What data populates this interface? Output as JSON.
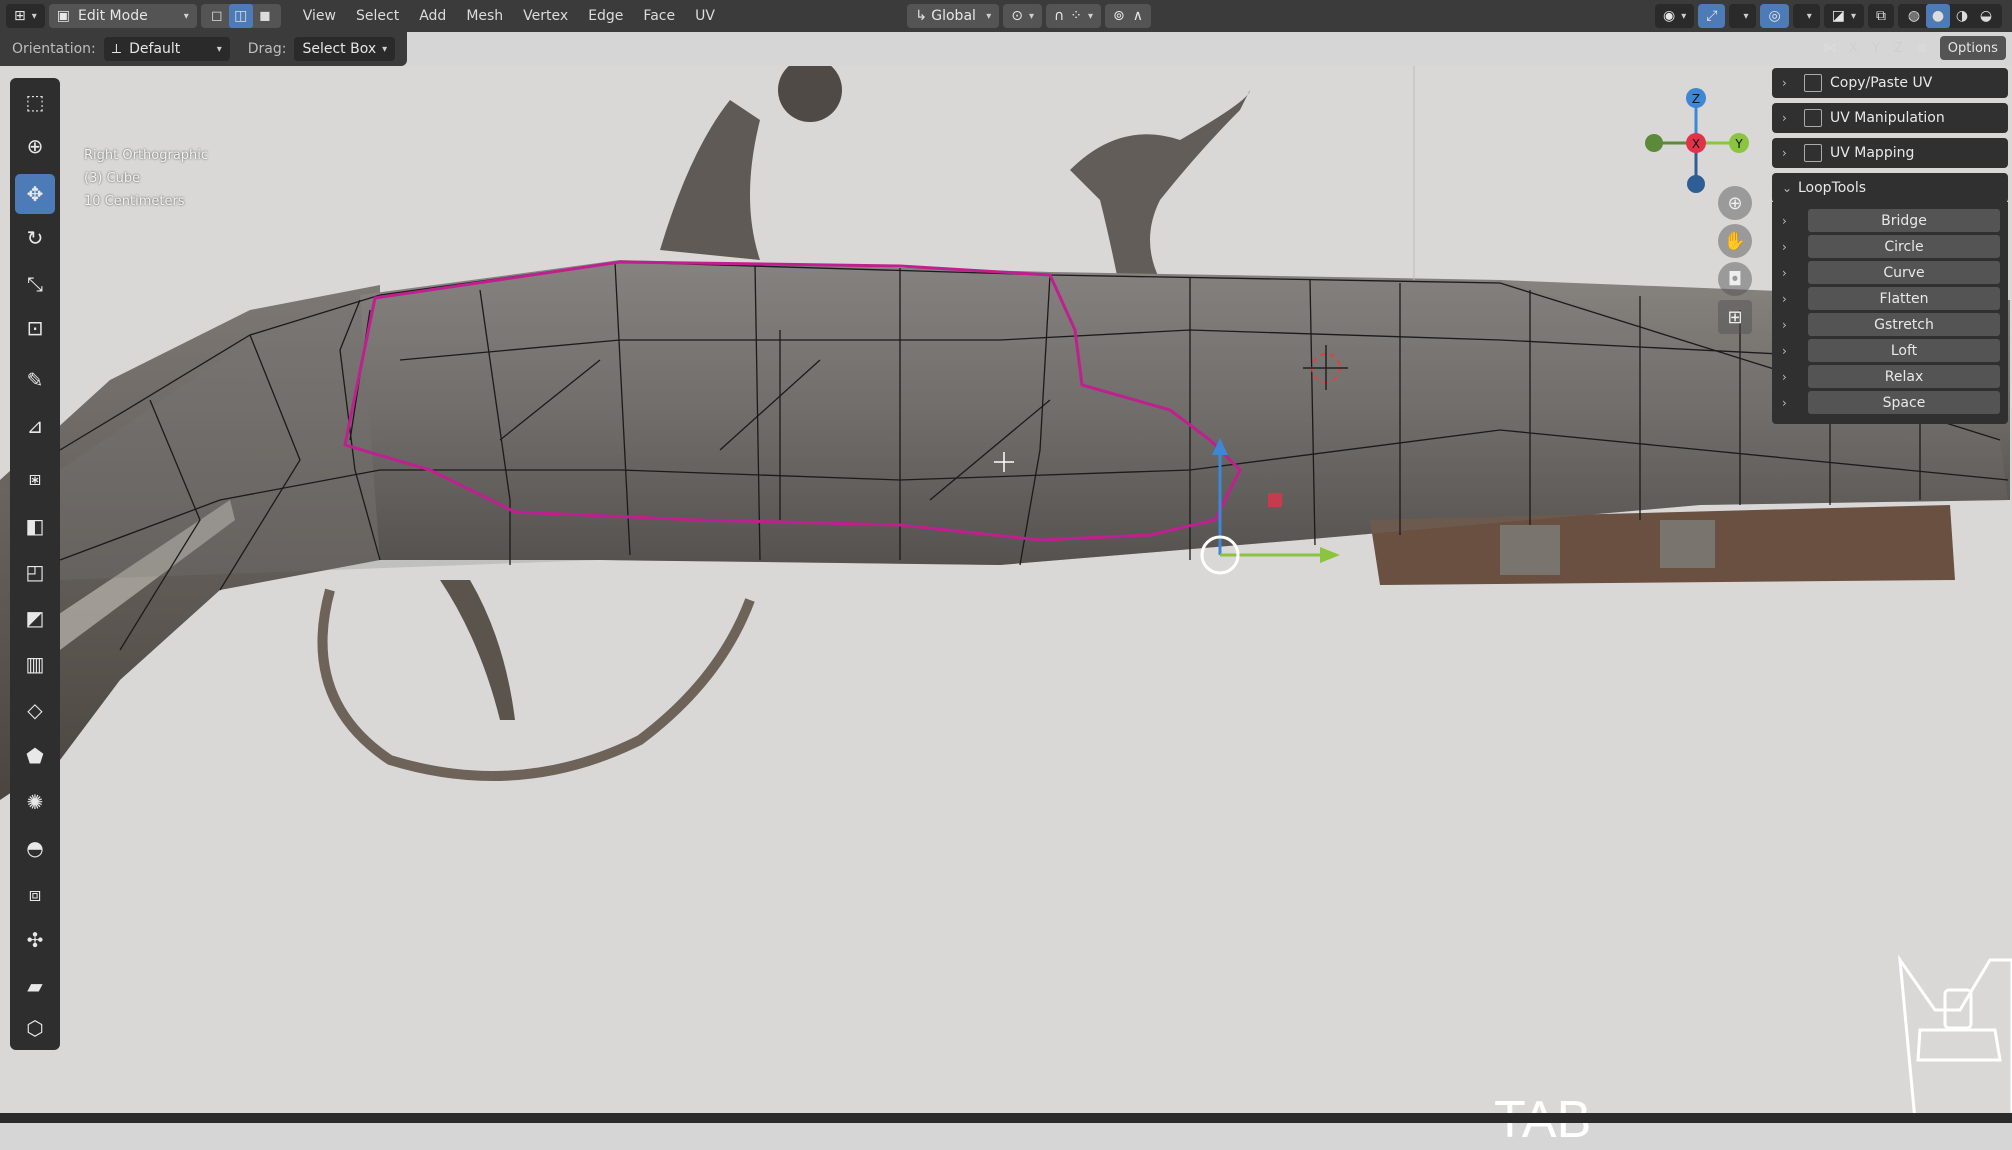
{
  "header": {
    "mode": "Edit Mode",
    "menus": [
      "View",
      "Select",
      "Add",
      "Mesh",
      "Vertex",
      "Edge",
      "Face",
      "UV"
    ],
    "transform_orientation": "Global",
    "options_label": "Options",
    "axes": [
      "X",
      "Y",
      "Z"
    ]
  },
  "tool_settings": {
    "orientation_label": "Orientation:",
    "orientation_value": "Default",
    "drag_label": "Drag:",
    "drag_value": "Select Box"
  },
  "viewport_info": {
    "view_name": "Right Orthographic",
    "object": "(3) Cube",
    "scale": "10 Centimeters"
  },
  "gizmo": {
    "z": "Z",
    "x": "X",
    "y": "Y"
  },
  "panels": {
    "collapsed": [
      "Copy/Paste UV",
      "UV Manipulation",
      "UV Mapping"
    ],
    "looptools_title": "LoopTools",
    "looptools_items": [
      "Bridge",
      "Circle",
      "Curve",
      "Flatten",
      "Gstretch",
      "Loft",
      "Relax",
      "Space"
    ]
  },
  "overlay_key": "TAB",
  "colors": {
    "header_bg": "#3b3b3b",
    "active_tool": "#4d7bb8",
    "selection": "#c0208f",
    "axis_x": "#e0334a",
    "axis_y": "#8bc53f",
    "axis_z": "#3e86d6"
  }
}
